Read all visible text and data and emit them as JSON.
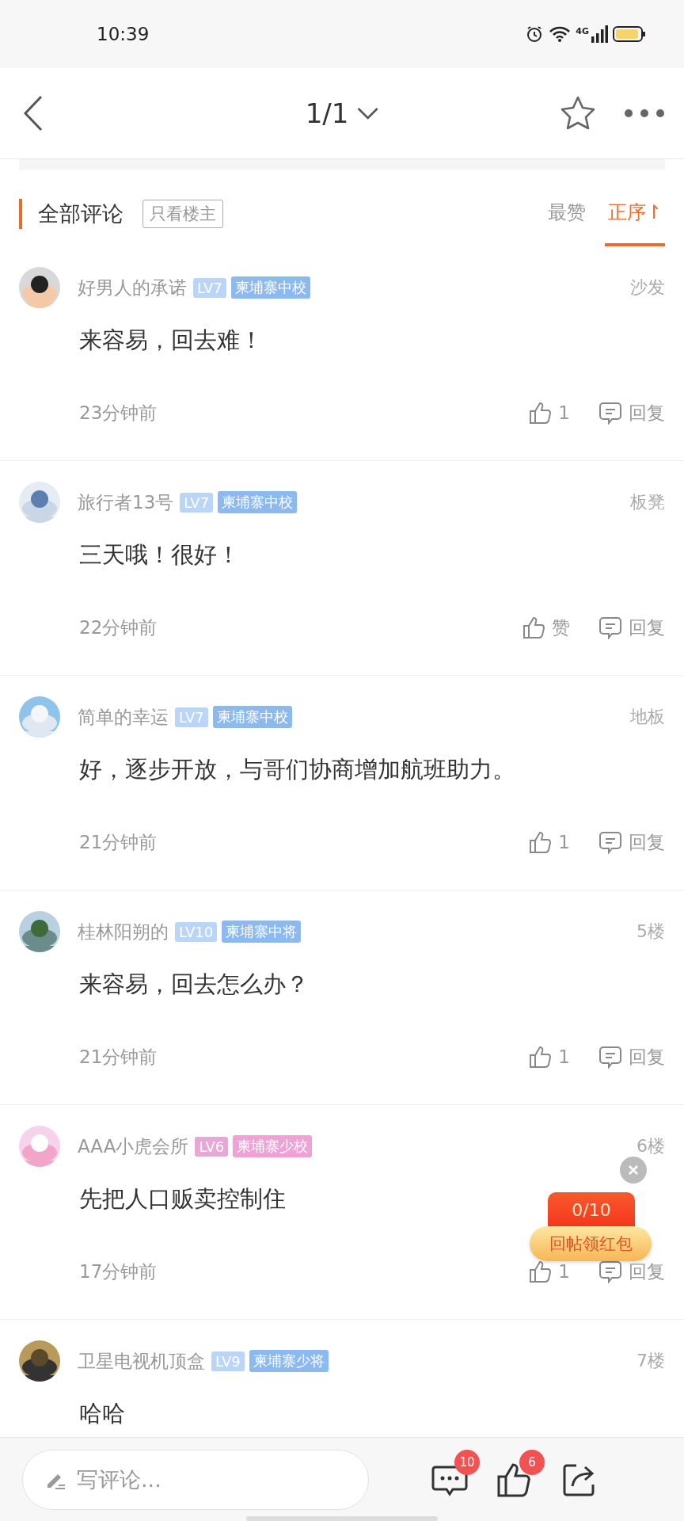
{
  "status_bar": {
    "time": "10:39",
    "network": "4G"
  },
  "header": {
    "title": "1/1"
  },
  "section": {
    "title": "全部评论",
    "filter": {
      "label": "只看楼主",
      "selected": false
    },
    "sort_tabs": [
      {
        "label": "最赞",
        "selected": false
      },
      {
        "label": "正序↾",
        "selected": true
      }
    ]
  },
  "comments": [
    {
      "user": "好男人的承诺",
      "badges": [
        {
          "text": "LV7",
          "color": "#b9d5f8"
        },
        {
          "text": "柬埔寨中校",
          "color": "#8db9f1"
        }
      ],
      "floor": "沙发",
      "text": "来容易，回去难！",
      "time": "23分钟前",
      "likes": "1",
      "reply": "回复"
    },
    {
      "user": "旅行者13号",
      "badges": [
        {
          "text": "LV7",
          "color": "#b9d5f8"
        },
        {
          "text": "柬埔寨中校",
          "color": "#8db9f1"
        }
      ],
      "floor": "板凳",
      "text": "三天哦！很好！",
      "time": "22分钟前",
      "likes": "赞",
      "reply": "回复"
    },
    {
      "user": "简单的幸运",
      "badges": [
        {
          "text": "LV7",
          "color": "#b9d5f8"
        },
        {
          "text": "柬埔寨中校",
          "color": "#8db9f1"
        }
      ],
      "floor": "地板",
      "text": "好，逐步开放，与哥们协商增加航班助力。",
      "time": "21分钟前",
      "likes": "1",
      "reply": "回复"
    },
    {
      "user": "桂林阳朔的",
      "badges": [
        {
          "text": "LV10",
          "color": "#b9d5f8"
        },
        {
          "text": "柬埔寨中将",
          "color": "#8db9f1"
        }
      ],
      "floor": "5楼",
      "text": "来容易，回去怎么办？",
      "time": "21分钟前",
      "likes": "1",
      "reply": "回复"
    },
    {
      "user": "AAA小虎会所",
      "badges": [
        {
          "text": "LV6",
          "color": "#eaa6d6"
        },
        {
          "text": "柬埔寨少校",
          "color": "#eea2d6"
        }
      ],
      "floor": "6楼",
      "text": "先把人口贩卖控制住",
      "time": "17分钟前",
      "likes": "1",
      "reply": "回复"
    },
    {
      "user": "卫星电视机顶盒",
      "badges": [
        {
          "text": "LV9",
          "color": "#b9d5f8"
        },
        {
          "text": "柬埔寨少将",
          "color": "#8db9f1"
        }
      ],
      "floor": "7楼",
      "text": "哈哈"
    }
  ],
  "red_packet_popup": {
    "progress": "0/10",
    "label": "回帖领红包"
  },
  "bottom_bar": {
    "placeholder": "写评论...",
    "comment_count": "10",
    "like_count": "6"
  }
}
